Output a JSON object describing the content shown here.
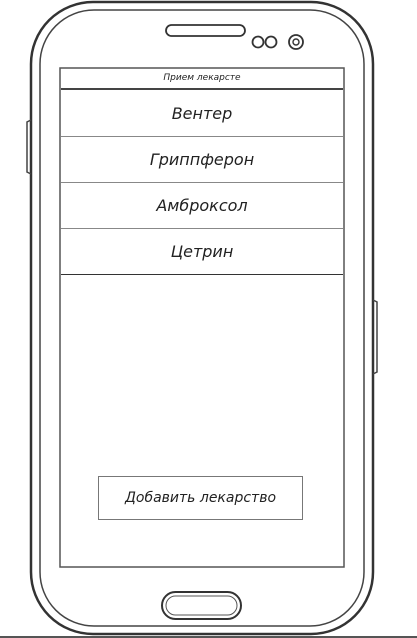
{
  "app": {
    "title": "Прием лекарсте"
  },
  "medications": [
    {
      "name": "Вентер"
    },
    {
      "name": "Гриппферон"
    },
    {
      "name": "Амброксол"
    },
    {
      "name": "Цетрин"
    }
  ],
  "actions": {
    "add_label": "Добавить лекарство"
  },
  "device": {
    "outline_color": "#333333",
    "screen_background": "#ffffff"
  }
}
